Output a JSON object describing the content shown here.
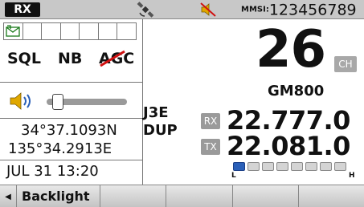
{
  "status": {
    "mode_badge": "RX",
    "gps_icon": "satellite-icon",
    "speaker_icon": "speaker-muted-icon",
    "mmsi_label": "MMSI:",
    "mmsi_value": "123456789"
  },
  "left": {
    "message_icon": "message-icon",
    "functions": {
      "sql": "SQL",
      "nb": "NB",
      "agc": "AGC",
      "agc_disabled": true
    },
    "volume_icon": "volume-icon",
    "volume_level": 0.08,
    "latitude": "34°37.1093N",
    "longitude": "135°34.2913E",
    "datetime": "JUL 31 13:20"
  },
  "right": {
    "channel": "26",
    "channel_badge": "CH",
    "channel_group": "GM800",
    "mode_line1": "J3E",
    "mode_line2": "DUP",
    "rx_tag": "RX",
    "rx_freq": "22.777.0",
    "tx_tag": "TX",
    "tx_freq": "22.081.0",
    "power": {
      "level": 1,
      "segments": 8,
      "low_label": "L",
      "high_label": "H"
    }
  },
  "softkeys": {
    "arrow": "◀",
    "backlight": "Backlight"
  },
  "colors": {
    "power_on": "#2a5fb8",
    "statusbar": "#c8c8c8"
  }
}
